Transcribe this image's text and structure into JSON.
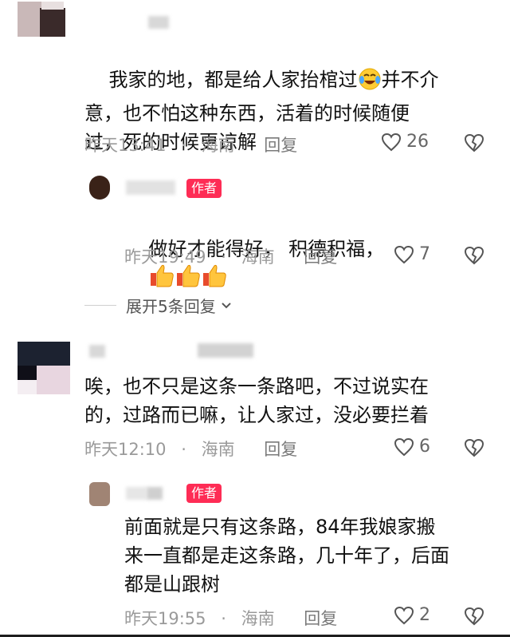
{
  "comments": [
    {
      "text_before_emoji": "我家的地，都是给人家抬棺过",
      "text_after_emoji": "并不介\n意，也不怕这种东西，活着的时候随便\n过，死的时候更谅解",
      "emoji": "crying-laughing-emoji",
      "time": "昨天13:41",
      "location": "海南",
      "reply_label": "回复",
      "likes": "26"
    },
    {
      "badge": "作者",
      "text": "做好才能得好， 积德积福，",
      "emoji": "thumbs-up-emoji",
      "time": "昨天19:49",
      "location": "海南",
      "reply_label": "回复",
      "likes": "7"
    },
    {
      "text": "唉，也不只是这条一条路吧，不过说实在\n的，过路而已嘛，让人家过，没必要拦着",
      "time": "昨天12:10",
      "location": "海南",
      "reply_label": "回复",
      "likes": "6"
    },
    {
      "badge": "作者",
      "text": "前面就是只有这条路，84年我娘家搬\n来一直都是走这条路，几十年了，后面\n都是山跟树",
      "time": "昨天19:55",
      "location": "海南",
      "reply_label": "回复",
      "likes": "2"
    }
  ],
  "expand_replies": "展开5条回复",
  "separator": "·",
  "colors": {
    "accent": "#fe2c55",
    "meta": "#9a9a9a"
  }
}
